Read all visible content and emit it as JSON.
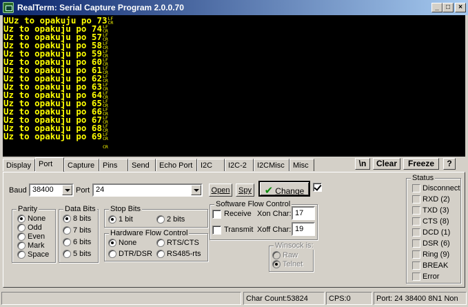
{
  "window": {
    "title": "RealTerm: Serial Capture Program 2.0.0.70",
    "minimize": "_",
    "maximize": "□",
    "close": "×"
  },
  "terminal": {
    "lines": [
      {
        "text": "UUz to opakuju po 73",
        "lf": "LF",
        "cr": "CR"
      },
      {
        "text": "Uz to opakuju po 74",
        "lf": "LF",
        "cr": "CR"
      },
      {
        "text": "Uz to opakuju po 57",
        "lf": "LF",
        "cr": "CR"
      },
      {
        "text": "Uz to opakuju po 58",
        "lf": "LF",
        "cr": "CR"
      },
      {
        "text": "Uz to opakuju po 59",
        "lf": "LF",
        "cr": "CR"
      },
      {
        "text": "Uz to opakuju po 60",
        "lf": "LF",
        "cr": "CR"
      },
      {
        "text": "Uz to opakuju po 61",
        "lf": "LF",
        "cr": "CR"
      },
      {
        "text": "Uz to opakuju po 62",
        "lf": "LF",
        "cr": "CR"
      },
      {
        "text": "Uz to opakuju po 63",
        "lf": "LF",
        "cr": "CR"
      },
      {
        "text": "Uz to opakuju po 64",
        "lf": "LF",
        "cr": "CR"
      },
      {
        "text": "Uz to opakuju po 65",
        "lf": "LF",
        "cr": "CR"
      },
      {
        "text": "Uz to opakuju po 66",
        "lf": "LF",
        "cr": "CR"
      },
      {
        "text": "Uz to opakuju po 67",
        "lf": "LF",
        "cr": "CR"
      },
      {
        "text": "Uz to opakuju po 68",
        "lf": "LF",
        "cr": "CR"
      },
      {
        "text": "Uz to opakuju po 69",
        "lf": "LF",
        "cr": "CR"
      },
      {
        "text": "                   ",
        "lf": "",
        "cr": "CR"
      }
    ]
  },
  "tabs": [
    "Display",
    "Port",
    "Capture",
    "Pins",
    "Send",
    "Echo Port",
    "I2C",
    "I2C-2",
    "I2CMisc",
    "Misc"
  ],
  "active_tab": "Port",
  "toolbar": {
    "newline_btn": "\\n",
    "clear_btn": "Clear",
    "freeze_btn": "Freeze",
    "help_btn": "?"
  },
  "port": {
    "baud_label": "Baud",
    "baud_value": "38400",
    "port_label": "Port",
    "port_value": "24",
    "open_btn": "Open",
    "spy_btn": "Spy",
    "change_btn": "Change",
    "parity": {
      "title": "Parity",
      "options": [
        {
          "label": "None",
          "selected": true
        },
        {
          "label": "Odd",
          "selected": false
        },
        {
          "label": "Even",
          "selected": false
        },
        {
          "label": "Mark",
          "selected": false
        },
        {
          "label": "Space",
          "selected": false
        }
      ]
    },
    "databits": {
      "title": "Data Bits",
      "options": [
        {
          "label": "8 bits",
          "selected": true
        },
        {
          "label": "7 bits",
          "selected": false
        },
        {
          "label": "6 bits",
          "selected": false
        },
        {
          "label": "5 bits",
          "selected": false
        }
      ]
    },
    "stopbits": {
      "title": "Stop Bits",
      "opt1": "1 bit",
      "opt2": "2 bits"
    },
    "hwflow": {
      "title": "Hardware Flow Control",
      "none": "None",
      "rtscts": "RTS/CTS",
      "dtrdsr": "DTR/DSR",
      "rs485": "RS485-rts"
    },
    "swflow": {
      "title": "Software Flow Control",
      "receive": "Receive",
      "transmit": "Transmit",
      "xon_label": "Xon Char:",
      "xon_value": "17",
      "xoff_label": "Xoff Char:",
      "xoff_value": "19"
    },
    "winsock": {
      "title": "Winsock is:",
      "raw": "Raw",
      "telnet": "Telnet"
    }
  },
  "status": {
    "title": "Status",
    "items": [
      "Disconnect",
      "RXD (2)",
      "TXD (3)",
      "CTS (8)",
      "DCD (1)",
      "DSR (6)",
      "Ring (9)",
      "BREAK",
      "Error"
    ]
  },
  "statusbar": {
    "charcount": "Char Count:53824",
    "cps": "CPS:0",
    "portinfo": "Port: 24 38400 8N1 Non"
  },
  "colors": {
    "terminal_bg": "#000000",
    "terminal_text": "#ffff00",
    "titlebar_start": "#0a246a",
    "titlebar_end": "#a6caf0"
  }
}
